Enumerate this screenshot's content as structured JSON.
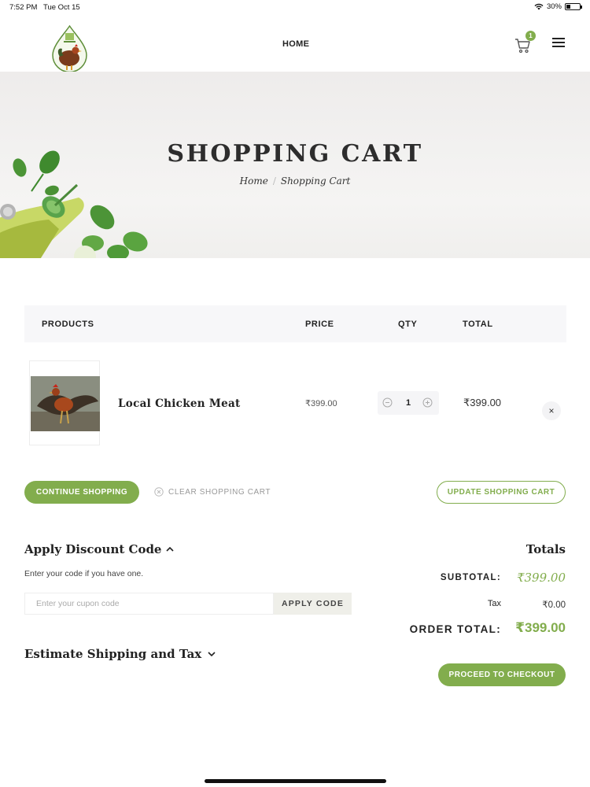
{
  "status_bar": {
    "time": "7:52 PM",
    "date": "Tue Oct 15",
    "battery": "30%"
  },
  "header": {
    "logo_icon": "farm-logo-rooster",
    "nav_home": "HOME",
    "cart_count": "1",
    "cart_icon": "cart-icon",
    "menu_icon": "hamburger-menu-icon"
  },
  "hero": {
    "title": "SHOPPING CART",
    "breadcrumb": {
      "home": "Home",
      "separator": "/",
      "current": "Shopping Cart"
    }
  },
  "cart_table": {
    "headers": {
      "products": "PRODUCTS",
      "price": "PRICE",
      "qty": "QTY",
      "total": "TOTAL"
    },
    "items": [
      {
        "name": "Local Chicken Meat",
        "price": "₹399.00",
        "qty": "1",
        "total": "₹399.00",
        "remove": "×"
      }
    ]
  },
  "actions": {
    "continue": "CONTINUE SHOPPING",
    "clear": "CLEAR SHOPPING CART",
    "update": "UPDATE SHOPPING CART"
  },
  "discount": {
    "title": "Apply Discount Code",
    "hint": "Enter your code if you have one.",
    "placeholder": "Enter your cupon code",
    "apply": "APPLY CODE"
  },
  "shipping": {
    "title": "Estimate Shipping and Tax"
  },
  "totals": {
    "title": "Totals",
    "subtotal_label": "SUBTOTAL:",
    "subtotal": "₹399.00",
    "tax_label": "Tax",
    "tax": "₹0.00",
    "order_total_label": "ORDER TOTAL:",
    "order_total": "₹399.00",
    "checkout": "PROCEED TO CHECKOUT"
  },
  "colors": {
    "accent": "#82ad4d",
    "header_bg": "#f7f7f9"
  }
}
